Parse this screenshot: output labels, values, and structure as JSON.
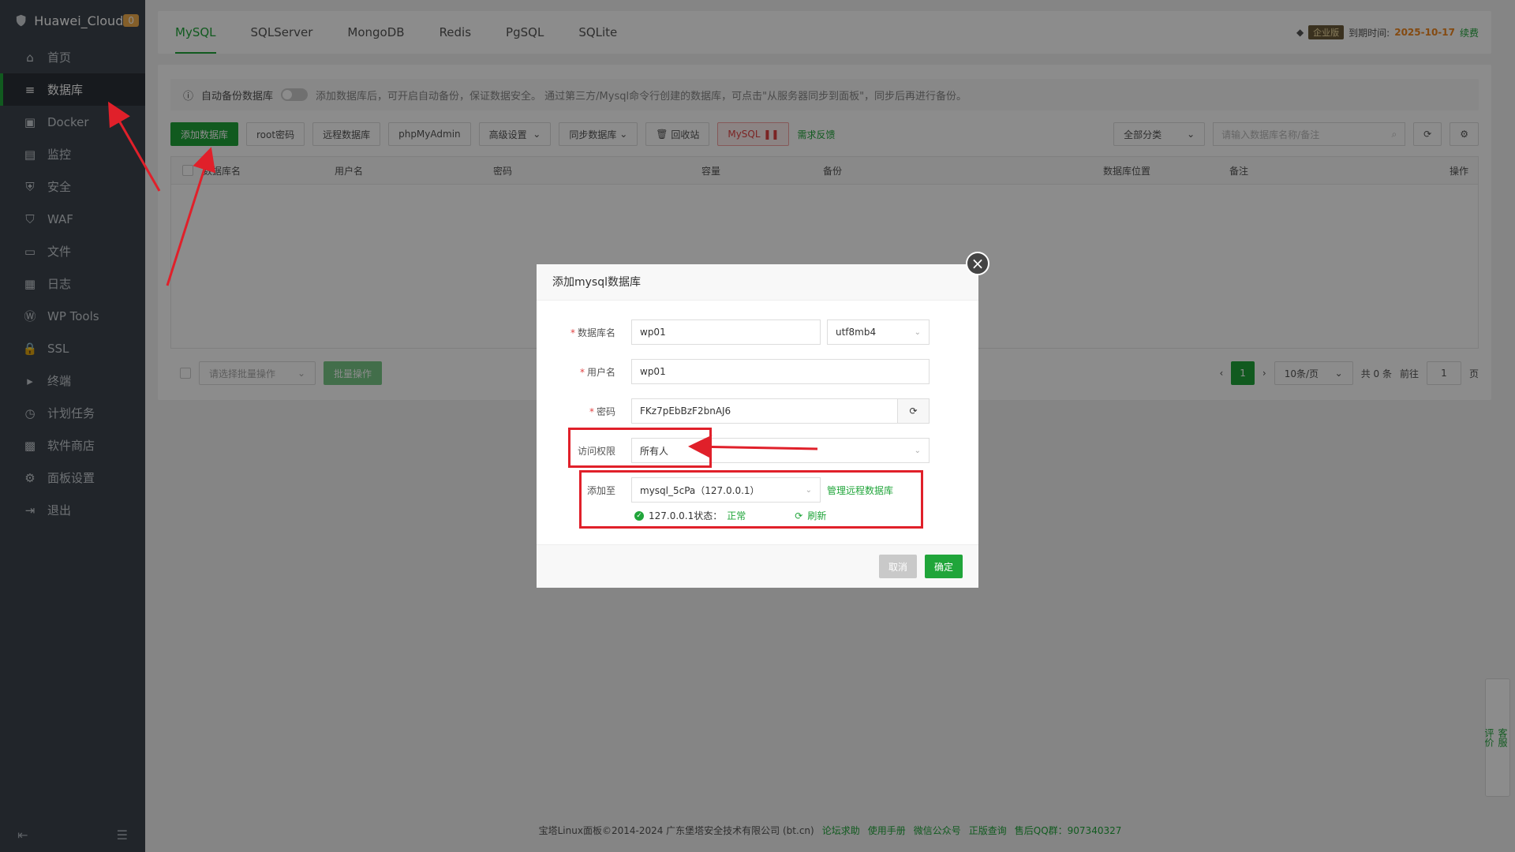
{
  "sidebar": {
    "brand": "Huawei_Cloud",
    "badge": "0",
    "items": [
      {
        "label": "首页",
        "icon": "home-icon"
      },
      {
        "label": "数据库",
        "icon": "database-icon"
      },
      {
        "label": "Docker",
        "icon": "docker-icon"
      },
      {
        "label": "监控",
        "icon": "monitor-icon"
      },
      {
        "label": "安全",
        "icon": "shield-icon"
      },
      {
        "label": "WAF",
        "icon": "waf-icon"
      },
      {
        "label": "文件",
        "icon": "folder-icon"
      },
      {
        "label": "日志",
        "icon": "log-icon"
      },
      {
        "label": "WP Tools",
        "icon": "wordpress-icon"
      },
      {
        "label": "SSL",
        "icon": "ssl-icon"
      },
      {
        "label": "终端",
        "icon": "terminal-icon"
      },
      {
        "label": "计划任务",
        "icon": "cron-icon"
      },
      {
        "label": "软件商店",
        "icon": "store-icon"
      },
      {
        "label": "面板设置",
        "icon": "settings-icon"
      },
      {
        "label": "退出",
        "icon": "logout-icon"
      }
    ]
  },
  "tabs": [
    "MySQL",
    "SQLServer",
    "MongoDB",
    "Redis",
    "PgSQL",
    "SQLite"
  ],
  "expiry": {
    "edition": "企业版",
    "label": "到期时间:",
    "date": "2025-10-17",
    "renew": "续费"
  },
  "notice": {
    "title": "自动备份数据库",
    "text": "添加数据库后，可开启自动备份，保证数据安全。 通过第三方/Mysql命令行创建的数据库，可点击\"从服务器同步到面板\"，同步后再进行备份。"
  },
  "toolbar": {
    "add": "添加数据库",
    "root": "root密码",
    "remote": "远程数据库",
    "pma": "phpMyAdmin",
    "advanced": "高级设置",
    "sync": "同步数据库",
    "recycle": "回收站",
    "mysql": "MySQL",
    "feedback": "需求反馈",
    "category": "全部分类",
    "search_placeholder": "请输入数据库名称/备注"
  },
  "table": {
    "headers": [
      "数据库名",
      "用户名",
      "密码",
      "容量",
      "备份",
      "数据库位置",
      "备注",
      "操作"
    ]
  },
  "pager": {
    "batch_placeholder": "请选择批量操作",
    "batch_btn": "批量操作",
    "page": "1",
    "per_page": "10条/页",
    "total": "共 0 条",
    "goto": "前往",
    "goto_val": "1",
    "page_unit": "页"
  },
  "footer": {
    "copyright": "宝塔Linux面板©2014-2024 广东堡塔安全技术有限公司 (bt.cn)",
    "links": [
      "论坛求助",
      "使用手册",
      "微信公众号",
      "正版查询",
      "售后QQ群：907340327"
    ]
  },
  "side_help": {
    "service": "客服",
    "rate": "评价"
  },
  "modal": {
    "title": "添加mysql数据库",
    "db_name_label": "数据库名",
    "db_name": "wp01",
    "charset": "utf8mb4",
    "user_label": "用户名",
    "user": "wp01",
    "pwd_label": "密码",
    "pwd": "FKz7pEbBzF2bnAJ6",
    "access_label": "访问权限",
    "access": "所有人",
    "add_to_label": "添加至",
    "add_to": "mysql_5cPa（127.0.0.1）",
    "manage_remote": "管理远程数据库",
    "status_prefix": "127.0.0.1状态：",
    "status": "正常",
    "refresh": "刷新",
    "cancel": "取消",
    "confirm": "确定"
  }
}
